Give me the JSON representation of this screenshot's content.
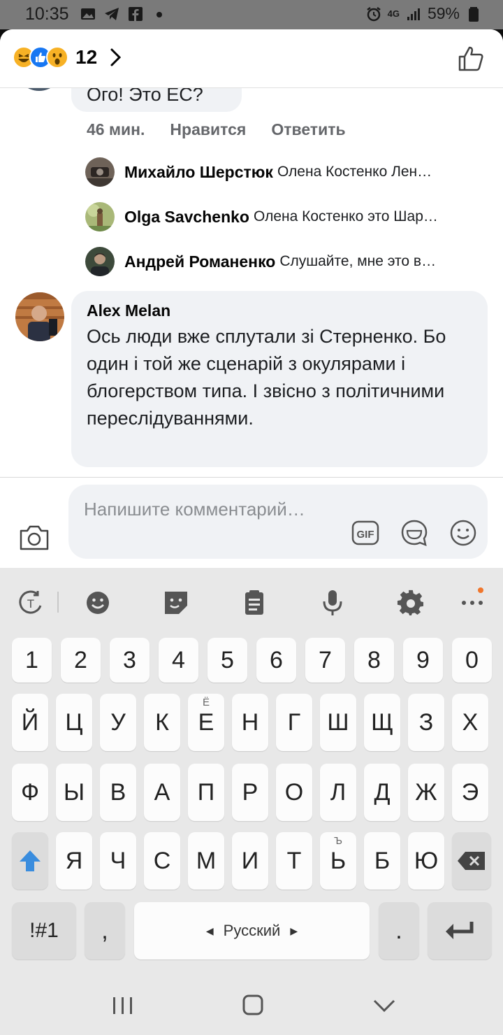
{
  "status_bar": {
    "time": "10:35",
    "battery": "59%",
    "network": "4G"
  },
  "header": {
    "reaction_count": "12"
  },
  "partial_comment": {
    "text": "Ого! Это ЕС?",
    "time": "46 мин.",
    "like_label": "Нравится",
    "reply_label": "Ответить"
  },
  "replies": [
    {
      "name": "Михайло Шерстюк",
      "text": "Олена Костенко Лен…"
    },
    {
      "name": "Olga Savchenko",
      "text": "Олена Костенко это Шар…"
    },
    {
      "name": "Андрей Романенко",
      "text": "Слушайте, мне это в…"
    }
  ],
  "main_comment": {
    "name": "Alex Melan",
    "text": "Ось люди вже сплутали зі Стерненко. Бо один і той же сценарій з окулярами і блогерством типа. І звісно з політичними переслідуваннями."
  },
  "input": {
    "placeholder": "Напишите комментарий…"
  },
  "keyboard": {
    "digits": [
      "1",
      "2",
      "3",
      "4",
      "5",
      "6",
      "7",
      "8",
      "9",
      "0"
    ],
    "row1": [
      "Й",
      "Ц",
      "У",
      "К",
      "Е",
      "Н",
      "Г",
      "Ш",
      "Щ",
      "З",
      "Х"
    ],
    "row1_hint": "Ё",
    "row2": [
      "Ф",
      "Ы",
      "В",
      "А",
      "П",
      "Р",
      "О",
      "Л",
      "Д",
      "Ж",
      "Э"
    ],
    "row3": [
      "Я",
      "Ч",
      "С",
      "М",
      "И",
      "Т",
      "Ь",
      "Б",
      "Ю"
    ],
    "row3_hint": "Ъ",
    "symbols_label": "!#1",
    "comma": ",",
    "space_label": "Русский",
    "period": "."
  },
  "colors": {
    "accent": "#1877f2",
    "shift_arrow": "#3a8dde",
    "bubble": "#f0f2f5",
    "meta_text": "#65676b"
  }
}
